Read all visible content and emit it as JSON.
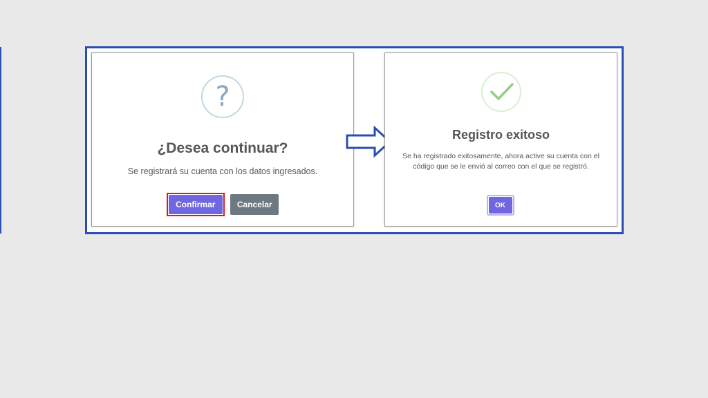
{
  "dialog_confirm": {
    "icon": "question-icon",
    "icon_glyph": "?",
    "title": "¿Desea continuar?",
    "message": "Se registrará su cuenta con los datos ingresados.",
    "confirm_label": "Confirmar",
    "cancel_label": "Cancelar"
  },
  "dialog_success": {
    "icon": "check-icon",
    "title": "Registro exitoso",
    "message": "Se ha registrado exitosamente, ahora active su cuenta con el código que se le envió al correo con el que se registró.",
    "ok_label": "OK"
  },
  "colors": {
    "frame_border": "#2a4db3",
    "primary_button": "#7066e0",
    "cancel_button": "#6e7881",
    "highlight_border": "#e0161d",
    "success_check": "#8ed081"
  }
}
